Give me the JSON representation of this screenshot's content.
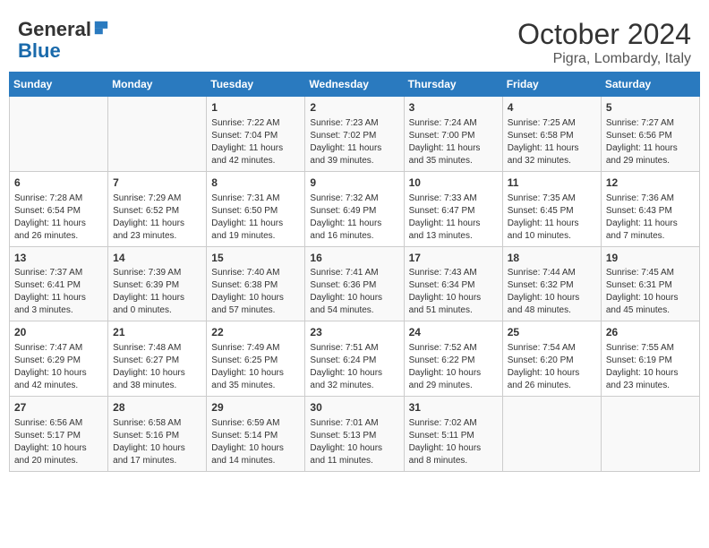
{
  "header": {
    "logo_general": "General",
    "logo_blue": "Blue",
    "title": "October 2024",
    "subtitle": "Pigra, Lombardy, Italy"
  },
  "days_of_week": [
    "Sunday",
    "Monday",
    "Tuesday",
    "Wednesday",
    "Thursday",
    "Friday",
    "Saturday"
  ],
  "weeks": [
    [
      {
        "day": "",
        "content": ""
      },
      {
        "day": "",
        "content": ""
      },
      {
        "day": "1",
        "content": "Sunrise: 7:22 AM\nSunset: 7:04 PM\nDaylight: 11 hours and 42 minutes."
      },
      {
        "day": "2",
        "content": "Sunrise: 7:23 AM\nSunset: 7:02 PM\nDaylight: 11 hours and 39 minutes."
      },
      {
        "day": "3",
        "content": "Sunrise: 7:24 AM\nSunset: 7:00 PM\nDaylight: 11 hours and 35 minutes."
      },
      {
        "day": "4",
        "content": "Sunrise: 7:25 AM\nSunset: 6:58 PM\nDaylight: 11 hours and 32 minutes."
      },
      {
        "day": "5",
        "content": "Sunrise: 7:27 AM\nSunset: 6:56 PM\nDaylight: 11 hours and 29 minutes."
      }
    ],
    [
      {
        "day": "6",
        "content": "Sunrise: 7:28 AM\nSunset: 6:54 PM\nDaylight: 11 hours and 26 minutes."
      },
      {
        "day": "7",
        "content": "Sunrise: 7:29 AM\nSunset: 6:52 PM\nDaylight: 11 hours and 23 minutes."
      },
      {
        "day": "8",
        "content": "Sunrise: 7:31 AM\nSunset: 6:50 PM\nDaylight: 11 hours and 19 minutes."
      },
      {
        "day": "9",
        "content": "Sunrise: 7:32 AM\nSunset: 6:49 PM\nDaylight: 11 hours and 16 minutes."
      },
      {
        "day": "10",
        "content": "Sunrise: 7:33 AM\nSunset: 6:47 PM\nDaylight: 11 hours and 13 minutes."
      },
      {
        "day": "11",
        "content": "Sunrise: 7:35 AM\nSunset: 6:45 PM\nDaylight: 11 hours and 10 minutes."
      },
      {
        "day": "12",
        "content": "Sunrise: 7:36 AM\nSunset: 6:43 PM\nDaylight: 11 hours and 7 minutes."
      }
    ],
    [
      {
        "day": "13",
        "content": "Sunrise: 7:37 AM\nSunset: 6:41 PM\nDaylight: 11 hours and 3 minutes."
      },
      {
        "day": "14",
        "content": "Sunrise: 7:39 AM\nSunset: 6:39 PM\nDaylight: 11 hours and 0 minutes."
      },
      {
        "day": "15",
        "content": "Sunrise: 7:40 AM\nSunset: 6:38 PM\nDaylight: 10 hours and 57 minutes."
      },
      {
        "day": "16",
        "content": "Sunrise: 7:41 AM\nSunset: 6:36 PM\nDaylight: 10 hours and 54 minutes."
      },
      {
        "day": "17",
        "content": "Sunrise: 7:43 AM\nSunset: 6:34 PM\nDaylight: 10 hours and 51 minutes."
      },
      {
        "day": "18",
        "content": "Sunrise: 7:44 AM\nSunset: 6:32 PM\nDaylight: 10 hours and 48 minutes."
      },
      {
        "day": "19",
        "content": "Sunrise: 7:45 AM\nSunset: 6:31 PM\nDaylight: 10 hours and 45 minutes."
      }
    ],
    [
      {
        "day": "20",
        "content": "Sunrise: 7:47 AM\nSunset: 6:29 PM\nDaylight: 10 hours and 42 minutes."
      },
      {
        "day": "21",
        "content": "Sunrise: 7:48 AM\nSunset: 6:27 PM\nDaylight: 10 hours and 38 minutes."
      },
      {
        "day": "22",
        "content": "Sunrise: 7:49 AM\nSunset: 6:25 PM\nDaylight: 10 hours and 35 minutes."
      },
      {
        "day": "23",
        "content": "Sunrise: 7:51 AM\nSunset: 6:24 PM\nDaylight: 10 hours and 32 minutes."
      },
      {
        "day": "24",
        "content": "Sunrise: 7:52 AM\nSunset: 6:22 PM\nDaylight: 10 hours and 29 minutes."
      },
      {
        "day": "25",
        "content": "Sunrise: 7:54 AM\nSunset: 6:20 PM\nDaylight: 10 hours and 26 minutes."
      },
      {
        "day": "26",
        "content": "Sunrise: 7:55 AM\nSunset: 6:19 PM\nDaylight: 10 hours and 23 minutes."
      }
    ],
    [
      {
        "day": "27",
        "content": "Sunrise: 6:56 AM\nSunset: 5:17 PM\nDaylight: 10 hours and 20 minutes."
      },
      {
        "day": "28",
        "content": "Sunrise: 6:58 AM\nSunset: 5:16 PM\nDaylight: 10 hours and 17 minutes."
      },
      {
        "day": "29",
        "content": "Sunrise: 6:59 AM\nSunset: 5:14 PM\nDaylight: 10 hours and 14 minutes."
      },
      {
        "day": "30",
        "content": "Sunrise: 7:01 AM\nSunset: 5:13 PM\nDaylight: 10 hours and 11 minutes."
      },
      {
        "day": "31",
        "content": "Sunrise: 7:02 AM\nSunset: 5:11 PM\nDaylight: 10 hours and 8 minutes."
      },
      {
        "day": "",
        "content": ""
      },
      {
        "day": "",
        "content": ""
      }
    ]
  ]
}
